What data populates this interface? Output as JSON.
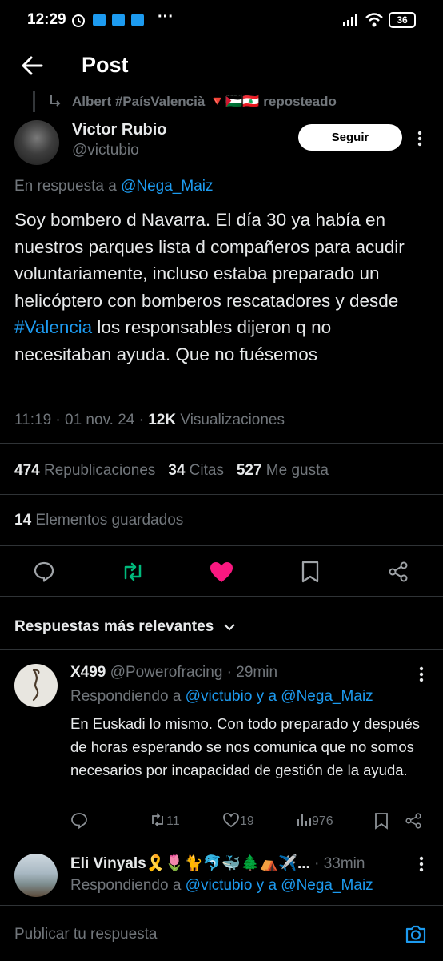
{
  "status_bar": {
    "time": "12:29",
    "battery": "36"
  },
  "header": {
    "title": "Post"
  },
  "repost": {
    "text": "Albert #PaísValencià 🔻🇵🇸🇱🇧 reposteado"
  },
  "tweet": {
    "author_name": "Victor Rubio",
    "author_handle": "@victubio",
    "follow_label": "Seguir",
    "reply_prefix": "En respuesta a",
    "reply_to": "@Nega_Maiz",
    "text_before": "Soy bombero d Navarra. El día 30 ya había en nuestros parques lista d compañeros para acudir voluntariamente, incluso estaba preparado un helicóptero con bomberos rescatadores y desde ",
    "hashtag": "#Valencia",
    "text_after": " los responsables dijeron q no necesitaban ayuda. Que no fuésemos",
    "time": "11:19 · 01 nov. 24 · ",
    "views_count": "12K",
    "views_label": " Visualizaciones",
    "reposts_count": "474",
    "reposts_label": "Republicaciones",
    "quotes_count": "34",
    "quotes_label": "Citas",
    "likes_count": "527",
    "likes_label": "Me gusta",
    "bookmarks_count": "14",
    "bookmarks_label": "Elementos guardados"
  },
  "replies_header": {
    "label": "Respuestas más relevantes"
  },
  "replies": [
    {
      "name": "X499",
      "handle": "@Powerofracing",
      "time": " · 29min",
      "replying_prefix": "Respondiendo a",
      "replying_to": "@victubio y a @Nega_Maiz",
      "text": "En Euskadi lo mismo. Con todo preparado y después de horas esperando se nos comunica que no somos necesarios por incapacidad de gestión de la ayuda.",
      "reposts": "11",
      "likes": "19",
      "views": "976"
    },
    {
      "name": "Eli Vinyals🎗️🌷🐈🐬🐳🌲⛺✈️...",
      "time": " · 33min",
      "replying_prefix": "Respondiendo a",
      "replying_to": "@victubio y a @Nega_Maiz"
    }
  ],
  "composer": {
    "placeholder": "Publicar tu respuesta"
  }
}
